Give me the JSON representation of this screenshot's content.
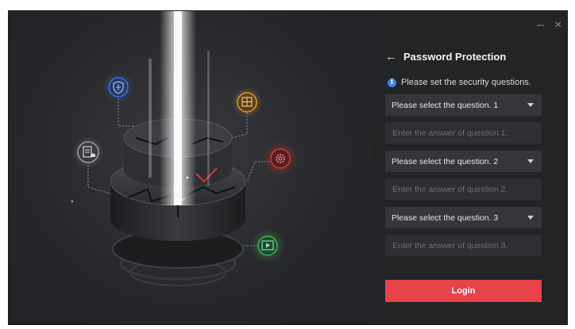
{
  "window": {
    "minimize_glyph": "–",
    "close_glyph": "×"
  },
  "header": {
    "back_glyph": "←",
    "title": "Password Protection"
  },
  "hint": {
    "icon": "info-icon",
    "icon_glyph": "i",
    "text": "Please set the security questions."
  },
  "questions": [
    {
      "select_label": "Please select the question. 1",
      "answer_placeholder": "Enter the answer of question 1."
    },
    {
      "select_label": "Please select the question. 2",
      "answer_placeholder": "Enter the answer of question 2."
    },
    {
      "select_label": "Please select the question. 3",
      "answer_placeholder": "Enter the answer of question 3."
    }
  ],
  "login_label": "Login",
  "colors": {
    "background": "#232426",
    "accent": "#e8424a",
    "info": "#3d84e6",
    "shield_icon": "#3b6fd6",
    "grid_icon": "#d99b3a",
    "gear_icon": "#d8363c",
    "screen_icon": "#3fae5a",
    "doc_icon": "#9a9a9a"
  },
  "illustration_icons": [
    "shield-icon",
    "grid-icon",
    "gear-icon",
    "document-bell-icon",
    "screen-play-icon"
  ]
}
